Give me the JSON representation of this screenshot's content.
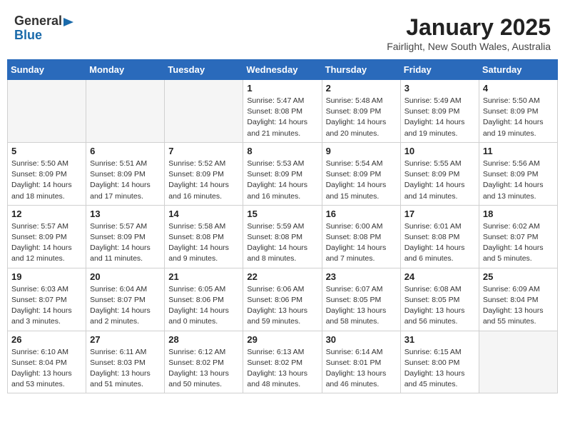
{
  "header": {
    "logo_general": "General",
    "logo_blue": "Blue",
    "month_title": "January 2025",
    "subtitle": "Fairlight, New South Wales, Australia"
  },
  "weekdays": [
    "Sunday",
    "Monday",
    "Tuesday",
    "Wednesday",
    "Thursday",
    "Friday",
    "Saturday"
  ],
  "weeks": [
    [
      {
        "day": "",
        "info": ""
      },
      {
        "day": "",
        "info": ""
      },
      {
        "day": "",
        "info": ""
      },
      {
        "day": "1",
        "info": "Sunrise: 5:47 AM\nSunset: 8:08 PM\nDaylight: 14 hours\nand 21 minutes."
      },
      {
        "day": "2",
        "info": "Sunrise: 5:48 AM\nSunset: 8:09 PM\nDaylight: 14 hours\nand 20 minutes."
      },
      {
        "day": "3",
        "info": "Sunrise: 5:49 AM\nSunset: 8:09 PM\nDaylight: 14 hours\nand 19 minutes."
      },
      {
        "day": "4",
        "info": "Sunrise: 5:50 AM\nSunset: 8:09 PM\nDaylight: 14 hours\nand 19 minutes."
      }
    ],
    [
      {
        "day": "5",
        "info": "Sunrise: 5:50 AM\nSunset: 8:09 PM\nDaylight: 14 hours\nand 18 minutes."
      },
      {
        "day": "6",
        "info": "Sunrise: 5:51 AM\nSunset: 8:09 PM\nDaylight: 14 hours\nand 17 minutes."
      },
      {
        "day": "7",
        "info": "Sunrise: 5:52 AM\nSunset: 8:09 PM\nDaylight: 14 hours\nand 16 minutes."
      },
      {
        "day": "8",
        "info": "Sunrise: 5:53 AM\nSunset: 8:09 PM\nDaylight: 14 hours\nand 16 minutes."
      },
      {
        "day": "9",
        "info": "Sunrise: 5:54 AM\nSunset: 8:09 PM\nDaylight: 14 hours\nand 15 minutes."
      },
      {
        "day": "10",
        "info": "Sunrise: 5:55 AM\nSunset: 8:09 PM\nDaylight: 14 hours\nand 14 minutes."
      },
      {
        "day": "11",
        "info": "Sunrise: 5:56 AM\nSunset: 8:09 PM\nDaylight: 14 hours\nand 13 minutes."
      }
    ],
    [
      {
        "day": "12",
        "info": "Sunrise: 5:57 AM\nSunset: 8:09 PM\nDaylight: 14 hours\nand 12 minutes."
      },
      {
        "day": "13",
        "info": "Sunrise: 5:57 AM\nSunset: 8:09 PM\nDaylight: 14 hours\nand 11 minutes."
      },
      {
        "day": "14",
        "info": "Sunrise: 5:58 AM\nSunset: 8:08 PM\nDaylight: 14 hours\nand 9 minutes."
      },
      {
        "day": "15",
        "info": "Sunrise: 5:59 AM\nSunset: 8:08 PM\nDaylight: 14 hours\nand 8 minutes."
      },
      {
        "day": "16",
        "info": "Sunrise: 6:00 AM\nSunset: 8:08 PM\nDaylight: 14 hours\nand 7 minutes."
      },
      {
        "day": "17",
        "info": "Sunrise: 6:01 AM\nSunset: 8:08 PM\nDaylight: 14 hours\nand 6 minutes."
      },
      {
        "day": "18",
        "info": "Sunrise: 6:02 AM\nSunset: 8:07 PM\nDaylight: 14 hours\nand 5 minutes."
      }
    ],
    [
      {
        "day": "19",
        "info": "Sunrise: 6:03 AM\nSunset: 8:07 PM\nDaylight: 14 hours\nand 3 minutes."
      },
      {
        "day": "20",
        "info": "Sunrise: 6:04 AM\nSunset: 8:07 PM\nDaylight: 14 hours\nand 2 minutes."
      },
      {
        "day": "21",
        "info": "Sunrise: 6:05 AM\nSunset: 8:06 PM\nDaylight: 14 hours\nand 0 minutes."
      },
      {
        "day": "22",
        "info": "Sunrise: 6:06 AM\nSunset: 8:06 PM\nDaylight: 13 hours\nand 59 minutes."
      },
      {
        "day": "23",
        "info": "Sunrise: 6:07 AM\nSunset: 8:05 PM\nDaylight: 13 hours\nand 58 minutes."
      },
      {
        "day": "24",
        "info": "Sunrise: 6:08 AM\nSunset: 8:05 PM\nDaylight: 13 hours\nand 56 minutes."
      },
      {
        "day": "25",
        "info": "Sunrise: 6:09 AM\nSunset: 8:04 PM\nDaylight: 13 hours\nand 55 minutes."
      }
    ],
    [
      {
        "day": "26",
        "info": "Sunrise: 6:10 AM\nSunset: 8:04 PM\nDaylight: 13 hours\nand 53 minutes."
      },
      {
        "day": "27",
        "info": "Sunrise: 6:11 AM\nSunset: 8:03 PM\nDaylight: 13 hours\nand 51 minutes."
      },
      {
        "day": "28",
        "info": "Sunrise: 6:12 AM\nSunset: 8:02 PM\nDaylight: 13 hours\nand 50 minutes."
      },
      {
        "day": "29",
        "info": "Sunrise: 6:13 AM\nSunset: 8:02 PM\nDaylight: 13 hours\nand 48 minutes."
      },
      {
        "day": "30",
        "info": "Sunrise: 6:14 AM\nSunset: 8:01 PM\nDaylight: 13 hours\nand 46 minutes."
      },
      {
        "day": "31",
        "info": "Sunrise: 6:15 AM\nSunset: 8:00 PM\nDaylight: 13 hours\nand 45 minutes."
      },
      {
        "day": "",
        "info": ""
      }
    ]
  ]
}
